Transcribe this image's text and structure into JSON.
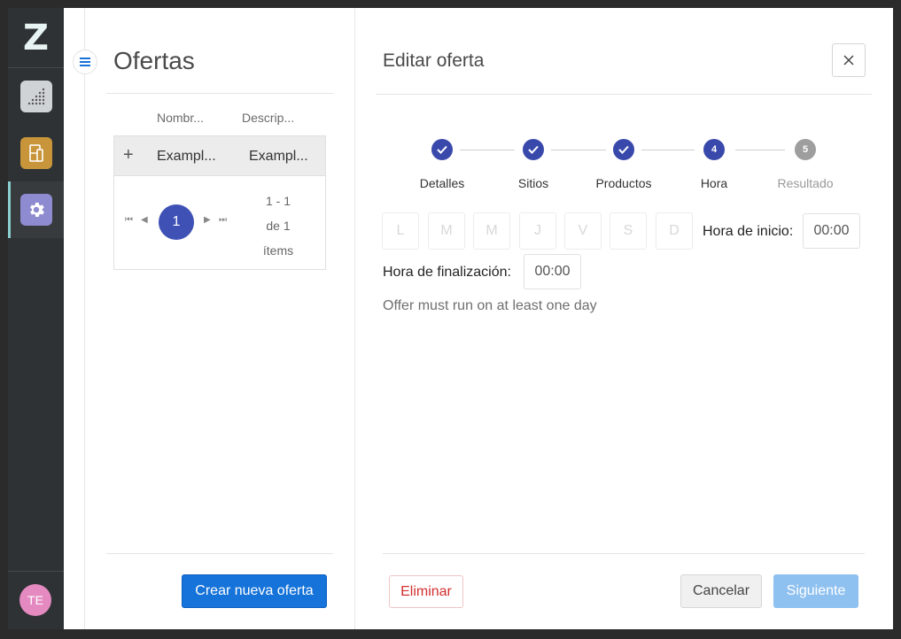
{
  "app": {
    "logo_text": "Z",
    "rail_items": [
      {
        "icon": "dots-chart-icon"
      },
      {
        "icon": "wine-bottle-icon"
      },
      {
        "icon": "gear-icon"
      }
    ],
    "avatar_initials": "TE"
  },
  "list": {
    "title": "Ofertas",
    "columns": [
      "Nombr...",
      "Descrip..."
    ],
    "add_symbol": "+",
    "rows": [
      {
        "name": "Exampl...",
        "description": "Exampl..."
      }
    ],
    "pager": {
      "current_page": "1",
      "info_lines": [
        "1 - 1",
        "de 1",
        "ítems"
      ]
    },
    "create_button": "Crear nueva oferta"
  },
  "editor": {
    "title": "Editar oferta",
    "close_symbol": "×",
    "steps": [
      {
        "label": "Detalles",
        "state": "done",
        "marker": "✓"
      },
      {
        "label": "Sitios",
        "state": "done",
        "marker": "✓"
      },
      {
        "label": "Productos",
        "state": "done",
        "marker": "✓"
      },
      {
        "label": "Hora",
        "state": "current",
        "marker": "4"
      },
      {
        "label": "Resultado",
        "state": "pending",
        "marker": "5"
      }
    ],
    "days": [
      "L",
      "M",
      "M",
      "J",
      "V",
      "S",
      "D"
    ],
    "start_label": "Hora de inicio:",
    "start_value": "00:00",
    "end_label": "Hora de finalización:",
    "end_value": "00:00",
    "hint": "Offer must run on at least one day",
    "buttons": {
      "delete": "Eliminar",
      "cancel": "Cancelar",
      "next": "Siguiente"
    }
  },
  "colors": {
    "primary": "#1673d9",
    "step_active": "#3949ab",
    "step_pending": "#9e9e9e",
    "danger": "#d32f2f",
    "next_disabled": "#8fc1f0"
  }
}
